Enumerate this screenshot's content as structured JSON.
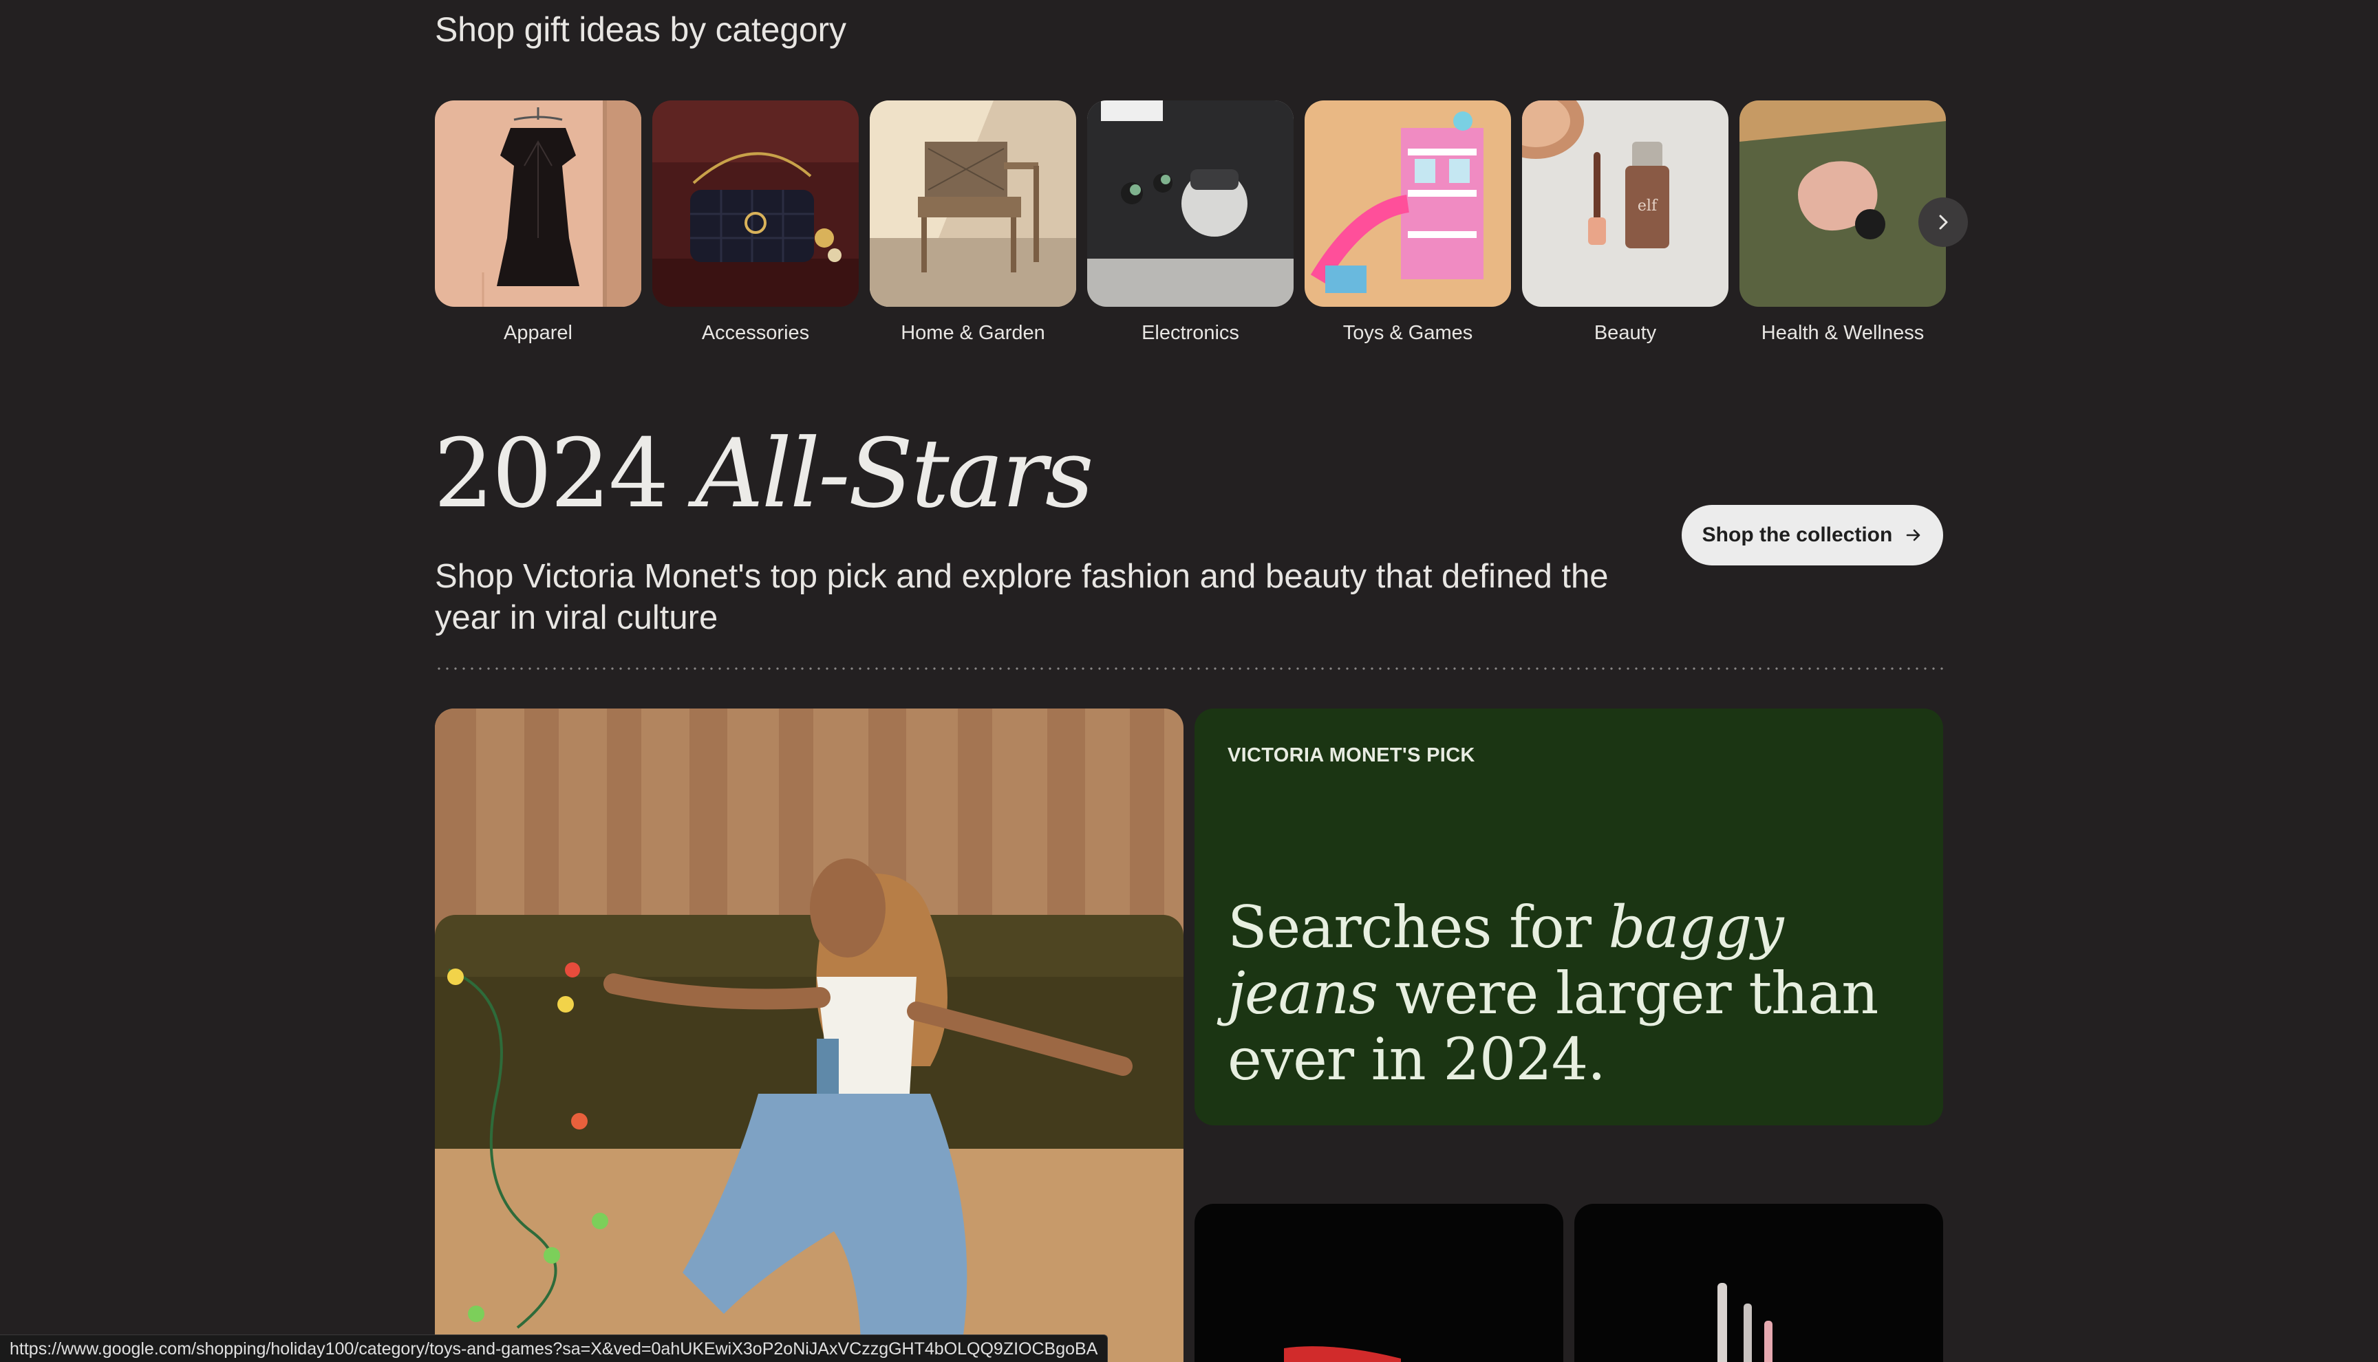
{
  "categories_section": {
    "heading": "Shop gift ideas by category",
    "items": [
      {
        "label": "Apparel"
      },
      {
        "label": "Accessories"
      },
      {
        "label": "Home & Garden"
      },
      {
        "label": "Electronics"
      },
      {
        "label": "Toys & Games"
      },
      {
        "label": "Beauty"
      },
      {
        "label": "Health & Wellness"
      }
    ],
    "next_icon": "chevron-right-icon"
  },
  "all_stars": {
    "title_year": "2024",
    "title_italic": "All-Stars",
    "subtitle": "Shop Victoria Monet's top pick and explore fashion and beauty that defined the year in viral culture",
    "button_label": "Shop the collection",
    "button_icon": "arrow-right-icon"
  },
  "pick_card": {
    "label": "VICTORIA MONET'S PICK",
    "text_before": "Searches for ",
    "text_italic": "baggy jeans",
    "text_after": " were larger than ever in 2024.",
    "background": "#1b3513"
  },
  "status_bar": {
    "url": "https://www.google.com/shopping/holiday100/category/toys-and-games?sa=X&ved=0ahUKEwiX3oP2oNiJAxVCzzgGHT4bOLQQ9ZIOCBgoBA"
  },
  "colors": {
    "page_background": "#232021",
    "button_background": "#ececec",
    "green_card": "#1b3513"
  }
}
